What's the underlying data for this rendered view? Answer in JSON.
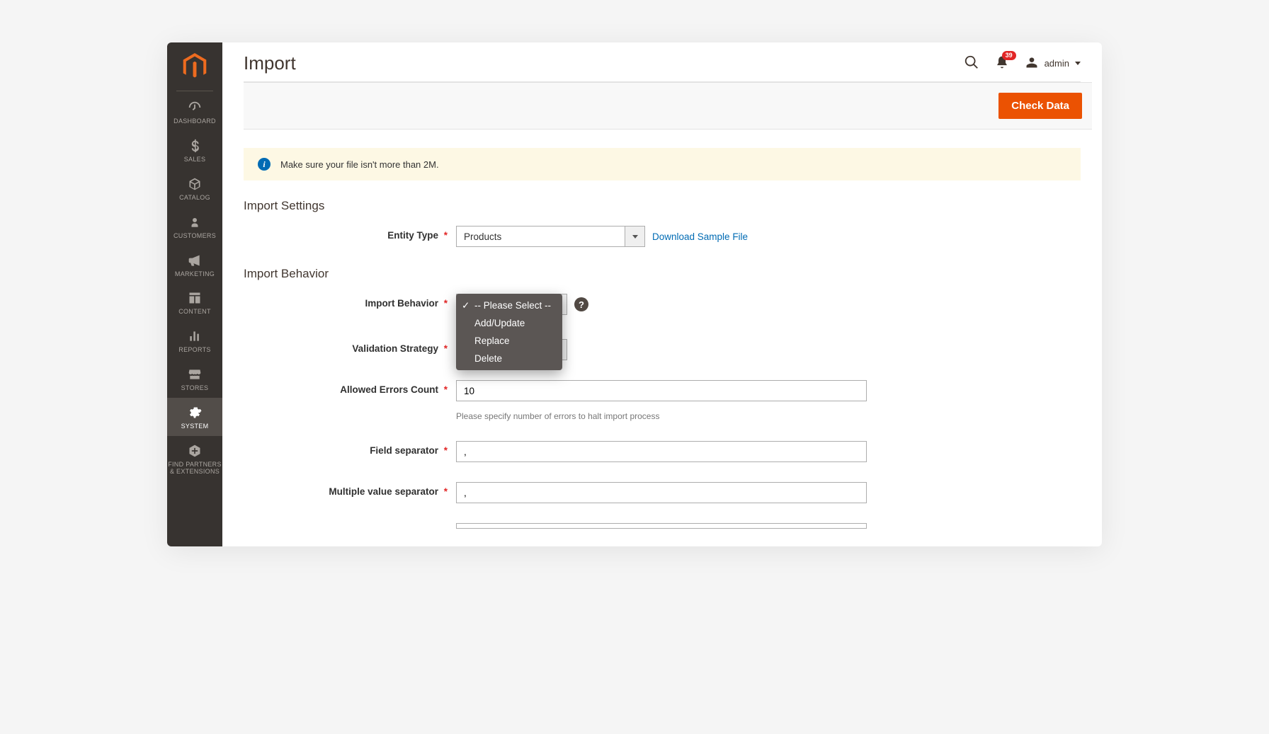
{
  "sidebar": {
    "items": [
      {
        "label": "DASHBOARD"
      },
      {
        "label": "SALES"
      },
      {
        "label": "CATALOG"
      },
      {
        "label": "CUSTOMERS"
      },
      {
        "label": "MARKETING"
      },
      {
        "label": "CONTENT"
      },
      {
        "label": "REPORTS"
      },
      {
        "label": "STORES"
      },
      {
        "label": "SYSTEM"
      },
      {
        "label": "FIND PARTNERS & EXTENSIONS"
      }
    ],
    "active_index": 8
  },
  "header": {
    "page_title": "Import",
    "notif_count": "39",
    "user_name": "admin"
  },
  "action_bar": {
    "check_data_label": "Check Data"
  },
  "notice": {
    "text": "Make sure your file isn't more than 2M."
  },
  "sections": {
    "import_settings_title": "Import Settings",
    "import_behavior_title": "Import Behavior"
  },
  "fields": {
    "entity_type": {
      "label": "Entity Type",
      "value": "Products",
      "sample_link": "Download Sample File"
    },
    "import_behavior": {
      "label": "Import Behavior",
      "options": [
        "-- Please Select --",
        "Add/Update",
        "Replace",
        "Delete"
      ],
      "selected": "-- Please Select --"
    },
    "validation_strategy": {
      "label": "Validation Strategy"
    },
    "allowed_errors": {
      "label": "Allowed Errors Count",
      "value": "10",
      "note": "Please specify number of errors to halt import process"
    },
    "field_separator": {
      "label": "Field separator",
      "value": ","
    },
    "multiple_value_separator": {
      "label": "Multiple value separator",
      "value": ","
    }
  }
}
